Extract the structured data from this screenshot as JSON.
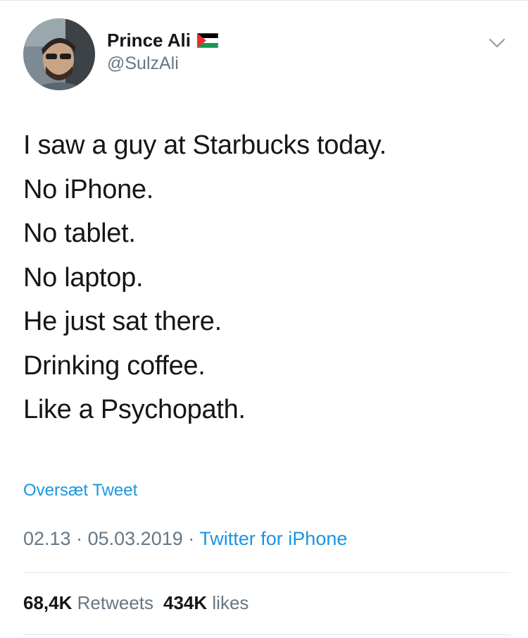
{
  "author": {
    "display_name": "Prince Ali",
    "handle": "@SulzAli",
    "flag_icon": "palestine-flag-icon"
  },
  "tweet": {
    "lines": [
      "I saw a guy at Starbucks today.",
      "No iPhone.",
      "No tablet.",
      "No laptop.",
      "He just sat there.",
      "Drinking coffee.",
      "Like a Psychopath."
    ],
    "translate_label": "Oversæt Tweet",
    "time": "02.13",
    "date": "05.03.2019",
    "separator": "·",
    "source": "Twitter for iPhone"
  },
  "stats": {
    "retweets_count": "68,4K",
    "retweets_label": "Retweets",
    "likes_count": "434K",
    "likes_label": "likes"
  },
  "colors": {
    "text": "#14171a",
    "secondary": "#657786",
    "link": "#1b95e0",
    "border": "#e1e8ed"
  }
}
